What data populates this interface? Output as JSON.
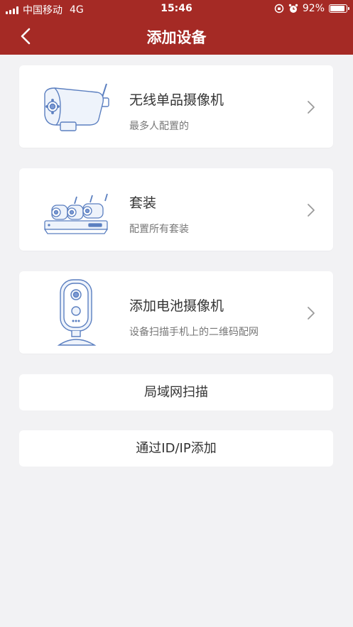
{
  "status": {
    "carrier": "中国移动",
    "network": "4G",
    "time": "15:46",
    "battery": "92%"
  },
  "header": {
    "title": "添加设备",
    "back_icon": "chevron-left-icon"
  },
  "colors": {
    "header_bg": "#a52a25",
    "page_bg": "#f2f2f4",
    "illustration_stroke": "#5b7fc0"
  },
  "devices": [
    {
      "title": "无线单品摄像机",
      "subtitle": "最多人配置的",
      "icon": "bullet-camera-icon"
    },
    {
      "title": "套装",
      "subtitle": "配置所有套装",
      "icon": "nvr-kit-icon"
    },
    {
      "title": "添加电池摄像机",
      "subtitle": "设备扫描手机上的二维码配网",
      "icon": "battery-camera-icon"
    }
  ],
  "actions": [
    {
      "label": "局域网扫描"
    },
    {
      "label": "通过ID/IP添加"
    }
  ]
}
